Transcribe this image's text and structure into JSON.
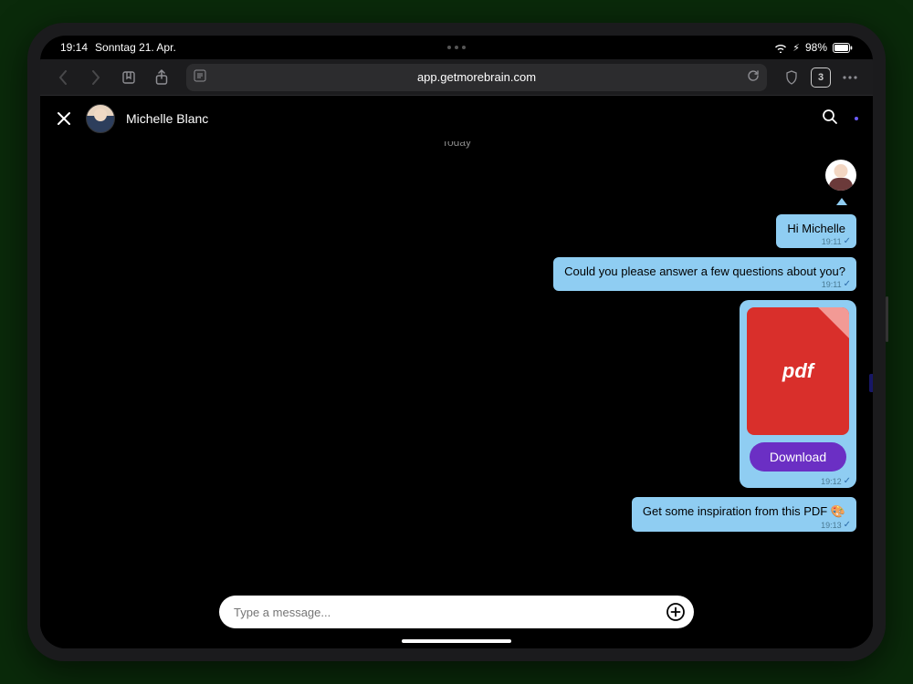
{
  "status": {
    "time": "19:14",
    "date": "Sonntag 21. Apr.",
    "battery_pct": "98%",
    "battery_icon": "battery-full-icon",
    "wifi_icon": "wifi-icon",
    "charging_icon": "charging-icon"
  },
  "browser": {
    "url_display": "app.getmorebrain.com",
    "tab_count": "3"
  },
  "chat": {
    "contact_name": "Michelle Blanc",
    "date_label": "Today",
    "messages": [
      {
        "text": "Hi Michelle",
        "time": "19:11",
        "side": "out",
        "status": "sent"
      },
      {
        "text": "Could you please answer a few questions about you?",
        "time": "19:11",
        "side": "out",
        "status": "sent"
      },
      {
        "type": "attachment",
        "file_label": "pdf",
        "download_label": "Download",
        "time": "19:12",
        "side": "out",
        "status": "sent"
      },
      {
        "text": "Get some inspiration from this PDF 🎨",
        "time": "19:13",
        "side": "out",
        "status": "sent"
      }
    ],
    "composer_placeholder": "Type a message..."
  }
}
